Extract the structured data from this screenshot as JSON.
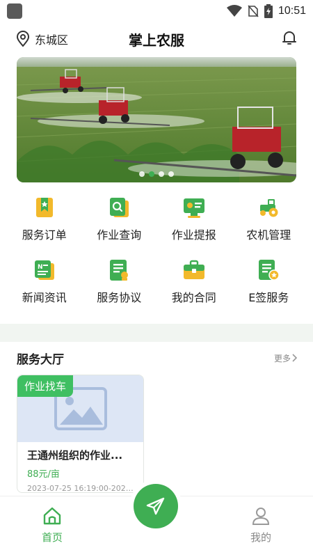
{
  "status_bar": {
    "time": "10:51"
  },
  "header": {
    "location": "东城区",
    "title": "掌上农服"
  },
  "banner": {
    "dot_count": 4,
    "active_dot": 2
  },
  "features": [
    {
      "label": "服务订单",
      "icon": "bookmark-order-icon"
    },
    {
      "label": "作业查询",
      "icon": "search-doc-icon"
    },
    {
      "label": "作业提报",
      "icon": "report-board-icon"
    },
    {
      "label": "农机管理",
      "icon": "tractor-icon"
    },
    {
      "label": "新闻资讯",
      "icon": "news-icon"
    },
    {
      "label": "服务协议",
      "icon": "agreement-icon"
    },
    {
      "label": "我的合同",
      "icon": "briefcase-icon"
    },
    {
      "label": "E签服务",
      "icon": "e-sign-icon"
    }
  ],
  "service_hall": {
    "title": "服务大厅",
    "more": "更多",
    "card": {
      "tag": "作业找车",
      "title": "王通州组织的作业...",
      "price": "88元/亩",
      "time": "2023-07-25 16:19:00-2023-0..."
    }
  },
  "tabbar": {
    "home": "首页",
    "mine": "我的"
  },
  "colors": {
    "accent": "#3fae53",
    "icon_yellow": "#f2b92b",
    "tag_green": "#3fbf62"
  }
}
